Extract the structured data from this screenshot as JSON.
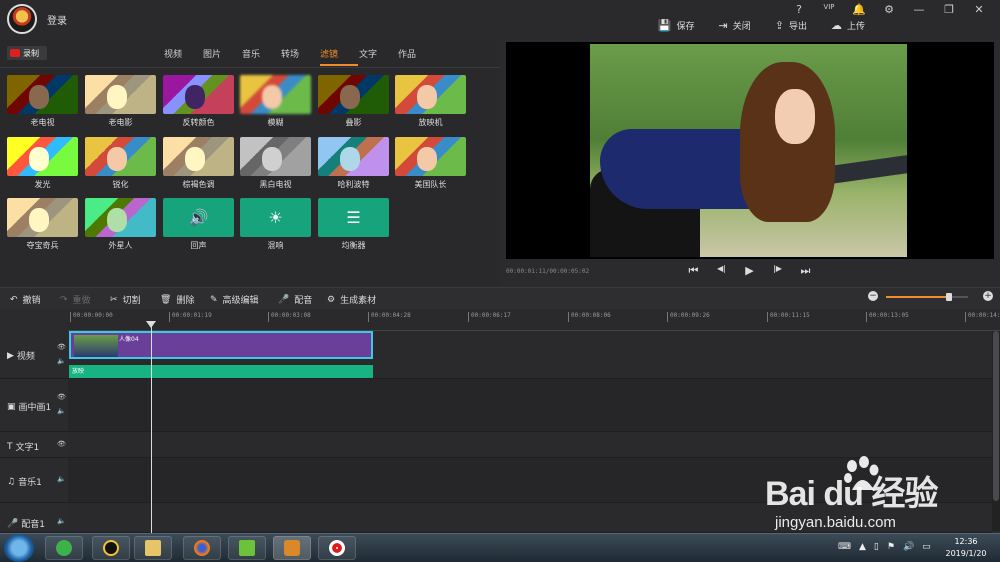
{
  "titlebar": {
    "login": "登录",
    "controls": [
      "?",
      "VIP",
      "🔔",
      "⚙",
      "—",
      "❐",
      "✕"
    ],
    "actions": [
      {
        "icon": "save-icon",
        "glyph": "💾",
        "label": "保存"
      },
      {
        "icon": "exit-icon",
        "glyph": "⇥",
        "label": "关闭"
      },
      {
        "icon": "export-icon",
        "glyph": "⇪",
        "label": "导出"
      },
      {
        "icon": "upload-icon",
        "glyph": "☁",
        "label": "上传"
      }
    ]
  },
  "left_panel": {
    "record_label": "录制",
    "tabs": [
      "视频",
      "图片",
      "音乐",
      "转场",
      "滤镜",
      "文字",
      "作品"
    ],
    "active_tab": "滤镜",
    "filters": [
      {
        "label": "老电视"
      },
      {
        "label": "老电影"
      },
      {
        "label": "反转颜色"
      },
      {
        "label": "模糊"
      },
      {
        "label": "叠影"
      },
      {
        "label": "放映机"
      },
      {
        "label": "发光"
      },
      {
        "label": "锐化"
      },
      {
        "label": "棕褐色调"
      },
      {
        "label": "黑白电视"
      },
      {
        "label": "哈利波特"
      },
      {
        "label": "美国队长"
      },
      {
        "label": "夺宝奇兵"
      },
      {
        "label": "外星人"
      },
      {
        "label": "回声"
      },
      {
        "label": "混响"
      },
      {
        "label": "均衡器"
      }
    ]
  },
  "preview": {
    "timecode": "00:00:01:11/00:00:05:02",
    "controls": [
      "⏮",
      "◀|",
      "▶",
      "|▶",
      "⏭"
    ]
  },
  "toolbar": {
    "undo": "撤销",
    "redo": "重做",
    "cut": "切割",
    "delete": "删除",
    "advanced_edit": "高级编辑",
    "dub": "配音",
    "generate": "生成素材",
    "zoom_level": 0.77
  },
  "timeline": {
    "ticks": [
      "00:00:00:00",
      "00:00:01:19",
      "00:00:03:08",
      "00:00:04:28",
      "00:00:06:17",
      "00:00:08:06",
      "00:00:09:26",
      "00:00:11:15",
      "00:00:13:05",
      "00:00:14:"
    ],
    "tracks": [
      {
        "name": "视频",
        "icon": "▶"
      },
      {
        "name": "画中画1",
        "icon": "▣"
      },
      {
        "name": "文字1",
        "icon": "T"
      },
      {
        "name": "音乐1",
        "icon": "♫"
      },
      {
        "name": "配音1",
        "icon": "🎤"
      }
    ],
    "clip_label": "人像04",
    "filter_bar_label": "放映"
  },
  "watermark": {
    "logo": "Bai  du 经验",
    "url": "jingyan.baidu.com"
  },
  "taskbar": {
    "time": "12:36",
    "date": "2019/1/20"
  }
}
